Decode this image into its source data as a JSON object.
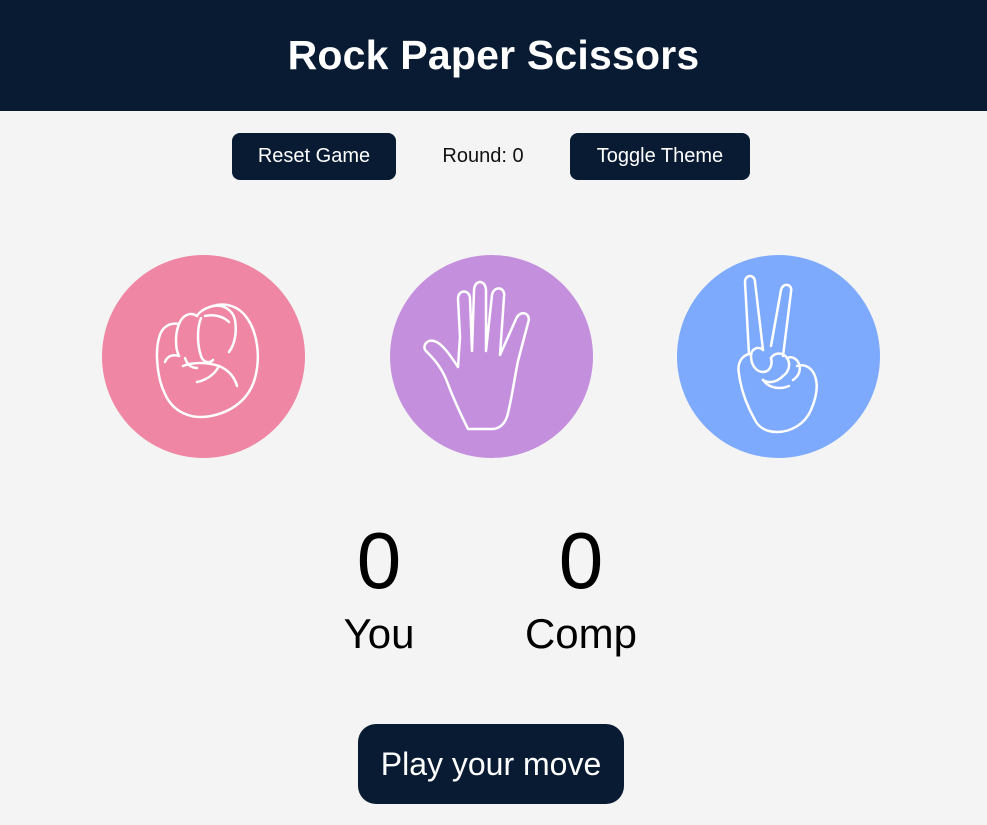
{
  "header": {
    "title": "Rock Paper Scissors"
  },
  "controls": {
    "reset_label": "Reset Game",
    "round_text": "Round: 0",
    "theme_label": "Toggle Theme"
  },
  "choices": [
    {
      "name": "rock",
      "icon": "fist-icon",
      "color": "#ef86a3"
    },
    {
      "name": "paper",
      "icon": "open-hand-icon",
      "color": "#c48fdd"
    },
    {
      "name": "scissors",
      "icon": "peace-sign-icon",
      "color": "#7daafc"
    }
  ],
  "scores": {
    "you": {
      "value": "0",
      "label": "You"
    },
    "comp": {
      "value": "0",
      "label": "Comp"
    }
  },
  "message": "Play your move",
  "colors": {
    "header_bg": "#081b33",
    "page_bg": "#f4f4f4",
    "button_bg": "#081b33",
    "text_on_dark": "#ffffff"
  }
}
